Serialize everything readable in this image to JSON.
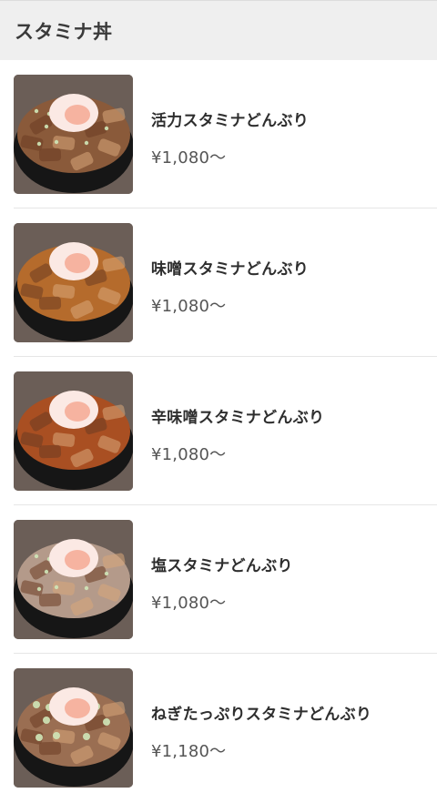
{
  "header": {
    "title": "スタミナ丼"
  },
  "items": [
    {
      "name": "活力スタミナどんぶり",
      "price": "¥1,080〜",
      "style": "classic"
    },
    {
      "name": "味噌スタミナどんぶり",
      "price": "¥1,080〜",
      "style": "miso"
    },
    {
      "name": "辛味噌スタミナどんぶり",
      "price": "¥1,080〜",
      "style": "spicy-miso"
    },
    {
      "name": "塩スタミナどんぶり",
      "price": "¥1,080〜",
      "style": "salt"
    },
    {
      "name": "ねぎたっぷりスタミナどんぶり",
      "price": "¥1,180〜",
      "style": "negi"
    }
  ],
  "colors": {
    "classic": "#8a5a3a",
    "miso": "#b56b2c",
    "spicy-miso": "#a94f22",
    "salt": "#b49a8a",
    "negi": "#9a6e52",
    "bowl": "#161616",
    "egg": "#fbe9e4",
    "yolk": "#f4a08a",
    "negi_green": "#cfe7b8"
  }
}
